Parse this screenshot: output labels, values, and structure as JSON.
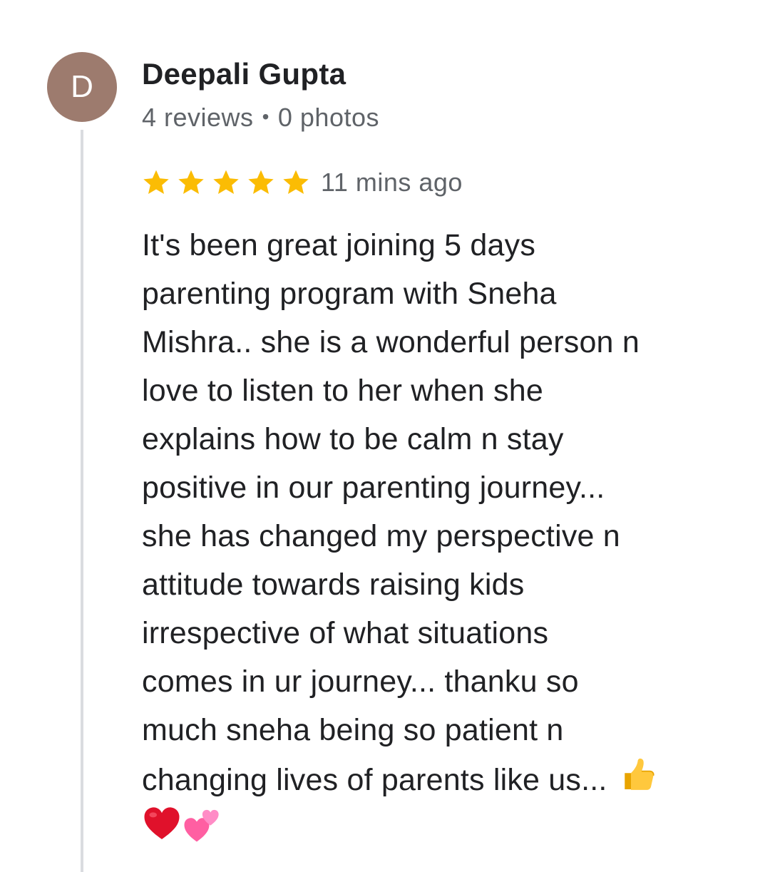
{
  "reviewer": {
    "initial": "D",
    "name": "Deepali Gupta",
    "reviews_count": "4 reviews",
    "separator": "•",
    "photos_count": "0 photos",
    "avatar_color": "#9d7b6e"
  },
  "rating": {
    "stars": 5,
    "max_stars": 5,
    "star_color": "#fbbc04",
    "time_ago": "11 mins ago"
  },
  "review": {
    "lines": [
      "It's been great joining 5 days",
      "parenting program with Sneha",
      "Mishra.. she is a wonderful person n",
      "love to listen to her when she",
      "explains how to be calm n stay",
      "positive in our parenting journey...",
      "she has changed my perspective n",
      "attitude towards raising kids",
      "irrespective of what situations",
      "comes in ur journey... thanku so",
      "much sneha being so patient n",
      "changing lives of parents like us..."
    ],
    "emojis": [
      "thumbs-up-icon",
      "red-heart-icon",
      "two-hearts-icon"
    ]
  }
}
